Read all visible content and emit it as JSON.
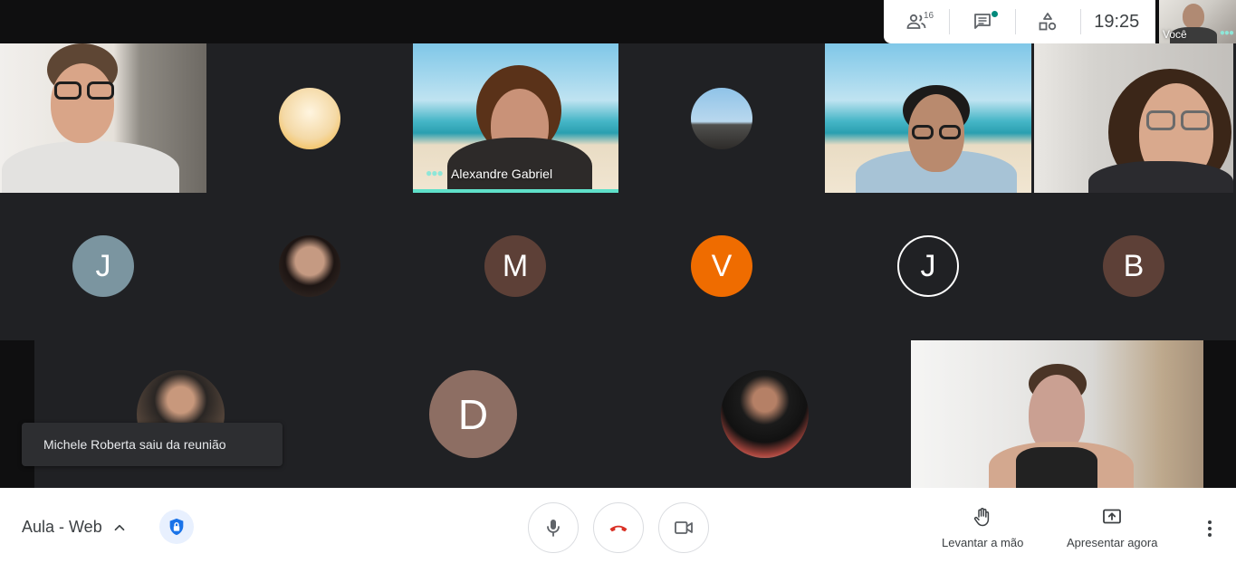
{
  "top_panel": {
    "participants_count": "16",
    "clock": "19:25",
    "self_label": "Você"
  },
  "tiles": {
    "speaker_name": "Alexandre Gabriel"
  },
  "avatars": {
    "row2": [
      "J",
      "M",
      "V",
      "J",
      "B"
    ],
    "row3_letter": "D",
    "colors": {
      "j_gray": "#7b95a0",
      "m_brown": "#5d4037",
      "v_orange": "#ef6c00",
      "j_dark": "#202124",
      "b_brown": "#5d4037",
      "d_rose": "#8d6e63"
    }
  },
  "toast": {
    "message": "Michele Roberta saiu da reunião"
  },
  "bottom_bar": {
    "meeting_name": "Aula - Web",
    "raise_hand_label": "Levantar a mão",
    "present_label": "Apresentar agora",
    "hangup_color": "#d93025",
    "accent_color": "#1a73e8"
  }
}
